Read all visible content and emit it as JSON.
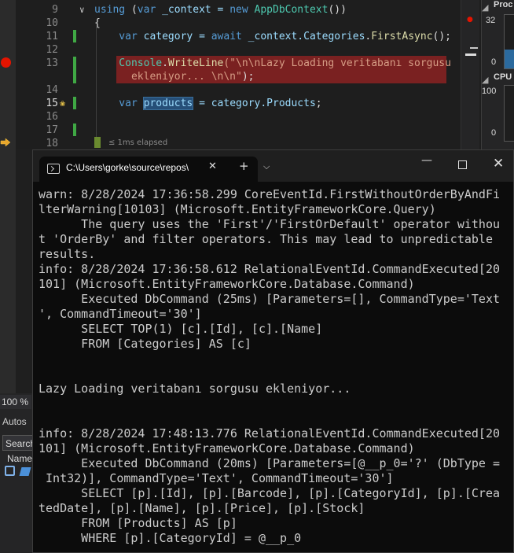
{
  "editor": {
    "lines": [
      {
        "num": "9",
        "tokens": [
          {
            "t": "using",
            "c": "kw"
          },
          {
            "t": " (",
            "c": ""
          },
          {
            "t": "var",
            "c": "kw"
          },
          {
            "t": " _context = ",
            "c": "id"
          },
          {
            "t": "new",
            "c": "kw"
          },
          {
            "t": " ",
            "c": ""
          },
          {
            "t": "AppDbContext",
            "c": "ty"
          },
          {
            "t": "())",
            "c": ""
          }
        ]
      },
      {
        "num": "10",
        "tokens": [
          {
            "t": "{",
            "c": ""
          }
        ]
      },
      {
        "num": "11",
        "tokens": [
          {
            "t": "    var",
            "c": "kw"
          },
          {
            "t": " category = ",
            "c": "id"
          },
          {
            "t": "await",
            "c": "kw"
          },
          {
            "t": " _context.",
            "c": "id"
          },
          {
            "t": "Categories",
            "c": "id"
          },
          {
            "t": ".",
            "c": ""
          },
          {
            "t": "FirstAsync",
            "c": "fn"
          },
          {
            "t": "();",
            "c": ""
          }
        ]
      },
      {
        "num": "12",
        "tokens": []
      },
      {
        "num": "13",
        "tokens": [
          {
            "t": "    Console",
            "c": "ty"
          },
          {
            "t": ".",
            "c": ""
          },
          {
            "t": "WriteLine",
            "c": "fn"
          },
          {
            "t": "(\"\\n\\nLazy Loading veritabanı sorgusu",
            "c": "str"
          }
        ]
      },
      {
        "num": "",
        "tokens": [
          {
            "t": "      ekleniyor... \\n\\n\"",
            "c": "str"
          },
          {
            "t": ");",
            "c": ""
          }
        ]
      },
      {
        "num": "14",
        "tokens": []
      },
      {
        "num": "15",
        "tokens": [
          {
            "t": "    var",
            "c": "kw"
          },
          {
            "t": " ",
            "c": ""
          },
          {
            "t": "products",
            "c": "hl"
          },
          {
            "t": " = category.",
            "c": "id"
          },
          {
            "t": "Products",
            "c": "id"
          },
          {
            "t": ";",
            "c": ""
          }
        ]
      },
      {
        "num": "16",
        "tokens": []
      },
      {
        "num": "17",
        "tokens": []
      },
      {
        "num": "18",
        "tokens": []
      }
    ],
    "elapsed": "≤ 1ms elapsed"
  },
  "diagnostics": {
    "title1": "Proc",
    "proc_max": "32",
    "proc_min": "0",
    "title2": "CPU",
    "cpu_max": "100",
    "cpu_min": "0"
  },
  "vs_panel": {
    "zoom": "100 %",
    "autos": "Autos",
    "search": "Search",
    "name": "Name"
  },
  "terminal": {
    "tab_title": "C:\\Users\\gorke\\source\\repos\\",
    "close": "✕",
    "new_tab": "+",
    "dropdown": "⌵",
    "minimize": "—",
    "win_close": "✕",
    "lines": [
      "warn: 8/28/2024 17:36:58.299 CoreEventId.FirstWithoutOrderByAndFi",
      "lterWarning[10103] (Microsoft.EntityFrameworkCore.Query)",
      "      The query uses the 'First'/'FirstOrDefault' operator withou",
      "t 'OrderBy' and filter operators. This may lead to unpredictable",
      "results.",
      "info: 8/28/2024 17:36:58.612 RelationalEventId.CommandExecuted[20",
      "101] (Microsoft.EntityFrameworkCore.Database.Command)",
      "      Executed DbCommand (25ms) [Parameters=[], CommandType='Text",
      "', CommandTimeout='30']",
      "      SELECT TOP(1) [c].[Id], [c].[Name]",
      "      FROM [Categories] AS [c]",
      "",
      "",
      "Lazy Loading veritabanı sorgusu ekleniyor...",
      "",
      "",
      "info: 8/28/2024 17:48:13.776 RelationalEventId.CommandExecuted[20",
      "101] (Microsoft.EntityFrameworkCore.Database.Command)",
      "      Executed DbCommand (20ms) [Parameters=[@__p_0='?' (DbType =",
      " Int32)], CommandType='Text', CommandTimeout='30']",
      "      SELECT [p].[Id], [p].[Barcode], [p].[CategoryId], [p].[Crea",
      "tedDate], [p].[Name], [p].[Price], [p].[Stock]",
      "      FROM [Products] AS [p]",
      "      WHERE [p].[CategoryId] = @__p_0"
    ]
  }
}
